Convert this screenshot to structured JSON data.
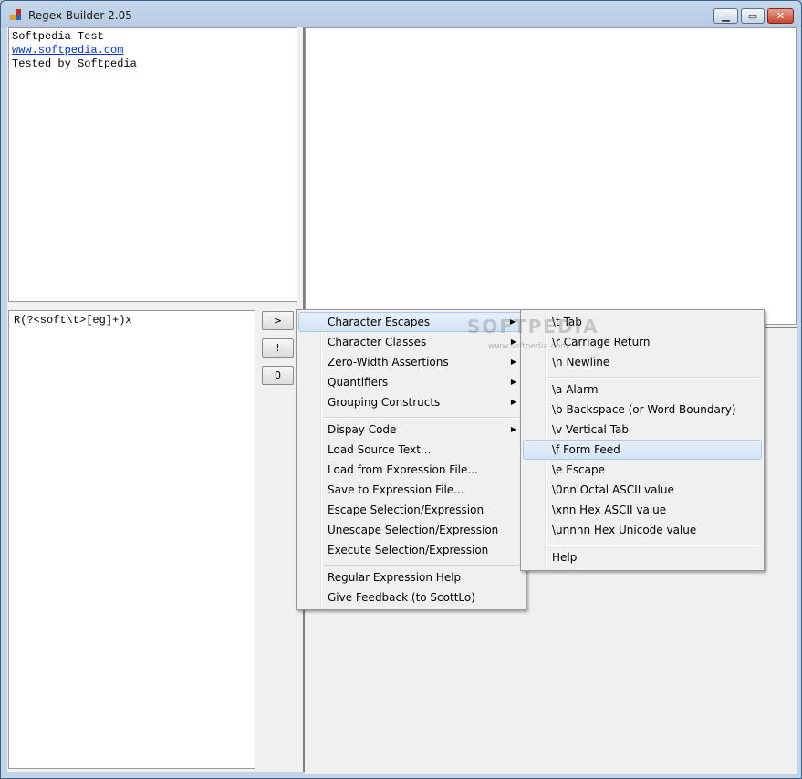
{
  "window": {
    "title": "Regex Builder 2.05"
  },
  "source_text": {
    "line1": "Softpedia Test",
    "line2": "www.softpedia.com",
    "line3": "Tested by Softpedia"
  },
  "expression": "R(?<soft\\t>[eg]+)x",
  "buttons": {
    "run": ">",
    "execute": "!",
    "zero": "0"
  },
  "context_menu": {
    "items": [
      {
        "label": "Character Escapes",
        "submenu": true,
        "highlighted": true
      },
      {
        "label": "Character Classes",
        "submenu": true
      },
      {
        "label": "Zero-Width Assertions",
        "submenu": true
      },
      {
        "label": "Quantifiers",
        "submenu": true
      },
      {
        "label": "Grouping Constructs",
        "submenu": true
      },
      {
        "label": "Dispay Code",
        "submenu": true
      },
      {
        "label": "Load Source Text..."
      },
      {
        "label": "Load from Expression File..."
      },
      {
        "label": "Save to Expression File..."
      },
      {
        "label": "Escape Selection/Expression"
      },
      {
        "label": "Unescape Selection/Expression"
      },
      {
        "label": "Execute Selection/Expression"
      },
      {
        "label": "Regular Expression Help"
      },
      {
        "label": "Give Feedback (to ScottLo)"
      }
    ]
  },
  "submenu": {
    "items": [
      {
        "label": "\\t Tab"
      },
      {
        "label": "\\r Carriage Return"
      },
      {
        "label": "\\n Newline"
      },
      {
        "label": "\\a Alarm"
      },
      {
        "label": "\\b Backspace (or Word Boundary)"
      },
      {
        "label": "\\v Vertical Tab"
      },
      {
        "label": "\\f Form Feed",
        "highlighted": true
      },
      {
        "label": "\\e Escape"
      },
      {
        "label": "\\0nn Octal ASCII value"
      },
      {
        "label": "\\xnn Hex ASCII value"
      },
      {
        "label": "\\unnnn Hex Unicode value"
      },
      {
        "label": "Help"
      }
    ]
  },
  "watermark": {
    "big": "SOFTPEDIA",
    "small": "www.softpedia.com"
  },
  "colors": {
    "highlight": "#d3e4f6",
    "link": "#0033cc",
    "close": "#c7452e"
  }
}
